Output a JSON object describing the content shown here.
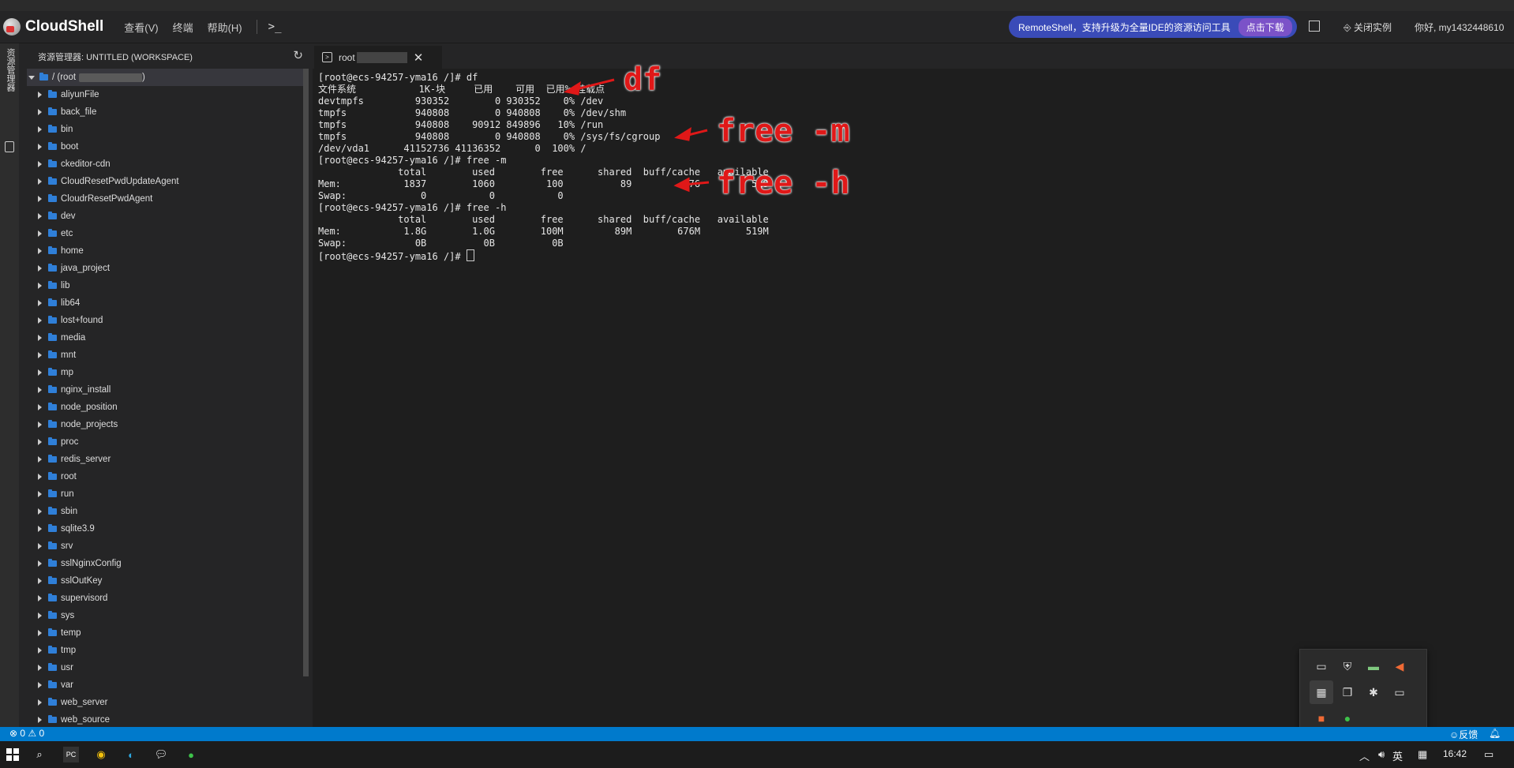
{
  "header": {
    "app_name": "CloudShell",
    "menu": [
      "查看(V)",
      "终端",
      "帮助(H)"
    ],
    "terminal_icon": "terminal-prompt-icon",
    "promo_text": "RemoteShell，支持升级为全量IDE的资源访问工具",
    "promo_button": "点击下载",
    "close_instance": "关闭实例",
    "user": "你好, my1432448610"
  },
  "activity": {
    "explorer_label": "资源管理器"
  },
  "explorer": {
    "title": "资源管理器: UNTITLED (WORKSPACE)",
    "root_label": "/ (root",
    "root_suffix": ")",
    "items": [
      "aliyunFile",
      "back_file",
      "bin",
      "boot",
      "ckeditor-cdn",
      "CloudResetPwdUpdateAgent",
      "CloudrResetPwdAgent",
      "dev",
      "etc",
      "home",
      "java_project",
      "lib",
      "lib64",
      "lost+found",
      "media",
      "mnt",
      "mp",
      "nginx_install",
      "node_position",
      "node_projects",
      "proc",
      "redis_server",
      "root",
      "run",
      "sbin",
      "sqlite3.9",
      "srv",
      "sslNginxConfig",
      "sslOutKey",
      "supervisord",
      "sys",
      "temp",
      "tmp",
      "usr",
      "var",
      "web_server",
      "web_source"
    ]
  },
  "terminal": {
    "tab_label": "root",
    "lines": [
      "[root@ecs-94257-yma16 /]# df",
      "文件系统           1K-块     已用    可用  已用% 挂载点",
      "devtmpfs         930352        0 930352    0% /dev",
      "tmpfs            940808        0 940808    0% /dev/shm",
      "tmpfs            940808    90912 849896   10% /run",
      "tmpfs            940808        0 940808    0% /sys/fs/cgroup",
      "/dev/vda1      41152736 41136352      0  100% /",
      "[root@ecs-94257-yma16 /]# free -m",
      "              total        used        free      shared  buff/cache   available",
      "Mem:           1837        1060         100          89         676         519",
      "Swap:             0           0           0",
      "[root@ecs-94257-yma16 /]# free -h",
      "              total        used        free      shared  buff/cache   available",
      "Mem:           1.8G        1.0G        100M         89M        676M        519M",
      "Swap:            0B          0B          0B"
    ],
    "prompt": "[root@ecs-94257-yma16 /]# "
  },
  "annotations": {
    "a1": "df",
    "a2": "free -m",
    "a3": "free -h",
    "color": "#e01818"
  },
  "statusbar": {
    "problems": "⊗ 0 ⚠ 0",
    "feedback": "☺反馈",
    "bell": "bell-icon"
  },
  "taskbar": {
    "ime": "英",
    "time": "16:42"
  },
  "colors": {
    "accent": "#007acc",
    "promo": "#3a4bb8",
    "folder": "#2f7fd8"
  }
}
